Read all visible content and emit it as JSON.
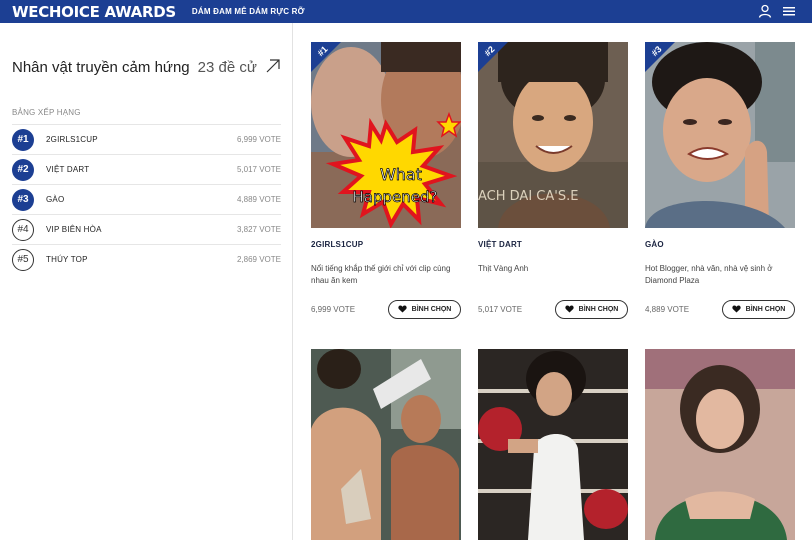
{
  "header": {
    "logo": "WECHOICE AWARDS",
    "slogan": "DÁM ĐAM MÊ DÁM RỰC RỠ",
    "icons": [
      "user-icon",
      "menu-icon"
    ],
    "brand_color": "#1c3f93"
  },
  "category": {
    "title": "Nhân vật truyền cảm hứng",
    "count": "23 đề cử"
  },
  "ranking": {
    "label": "BẢNG XẾP HẠNG",
    "items": [
      {
        "rank": "#1",
        "name": "2GIRLS1CUP",
        "votes": "6,999 VOTE"
      },
      {
        "rank": "#2",
        "name": "VIỆT DART",
        "votes": "5,017 VOTE"
      },
      {
        "rank": "#3",
        "name": "GÀO",
        "votes": "4,889 VOTE"
      },
      {
        "rank": "#4",
        "name": "VIP BIÊN HÒA",
        "votes": "3,827 VOTE"
      },
      {
        "rank": "#5",
        "name": "THÚY TOP",
        "votes": "2,869 VOTE"
      }
    ]
  },
  "nominees": [
    {
      "rank": "#1",
      "name": "2GIRLS1CUP",
      "desc": "Nổi tiếng khắp thế giới chỉ với clip cùng nhau ăn kem",
      "votes": "6,999 VOTE",
      "button": "BÌNH CHỌN",
      "thumb_text_1": "What",
      "thumb_text_2": "Happened?"
    },
    {
      "rank": "#2",
      "name": "VIỆT DART",
      "desc": "Thịt Vàng Anh",
      "votes": "5,017 VOTE",
      "button": "BÌNH CHỌN",
      "thumb_text_1": "ACH DAI CA'S.E"
    },
    {
      "rank": "#3",
      "name": "GÀO",
      "desc": "Hot Blogger, nhà văn, nhà vệ sinh ở Diamond Plaza",
      "votes": "4,889 VOTE",
      "button": "BÌNH CHỌN"
    }
  ]
}
